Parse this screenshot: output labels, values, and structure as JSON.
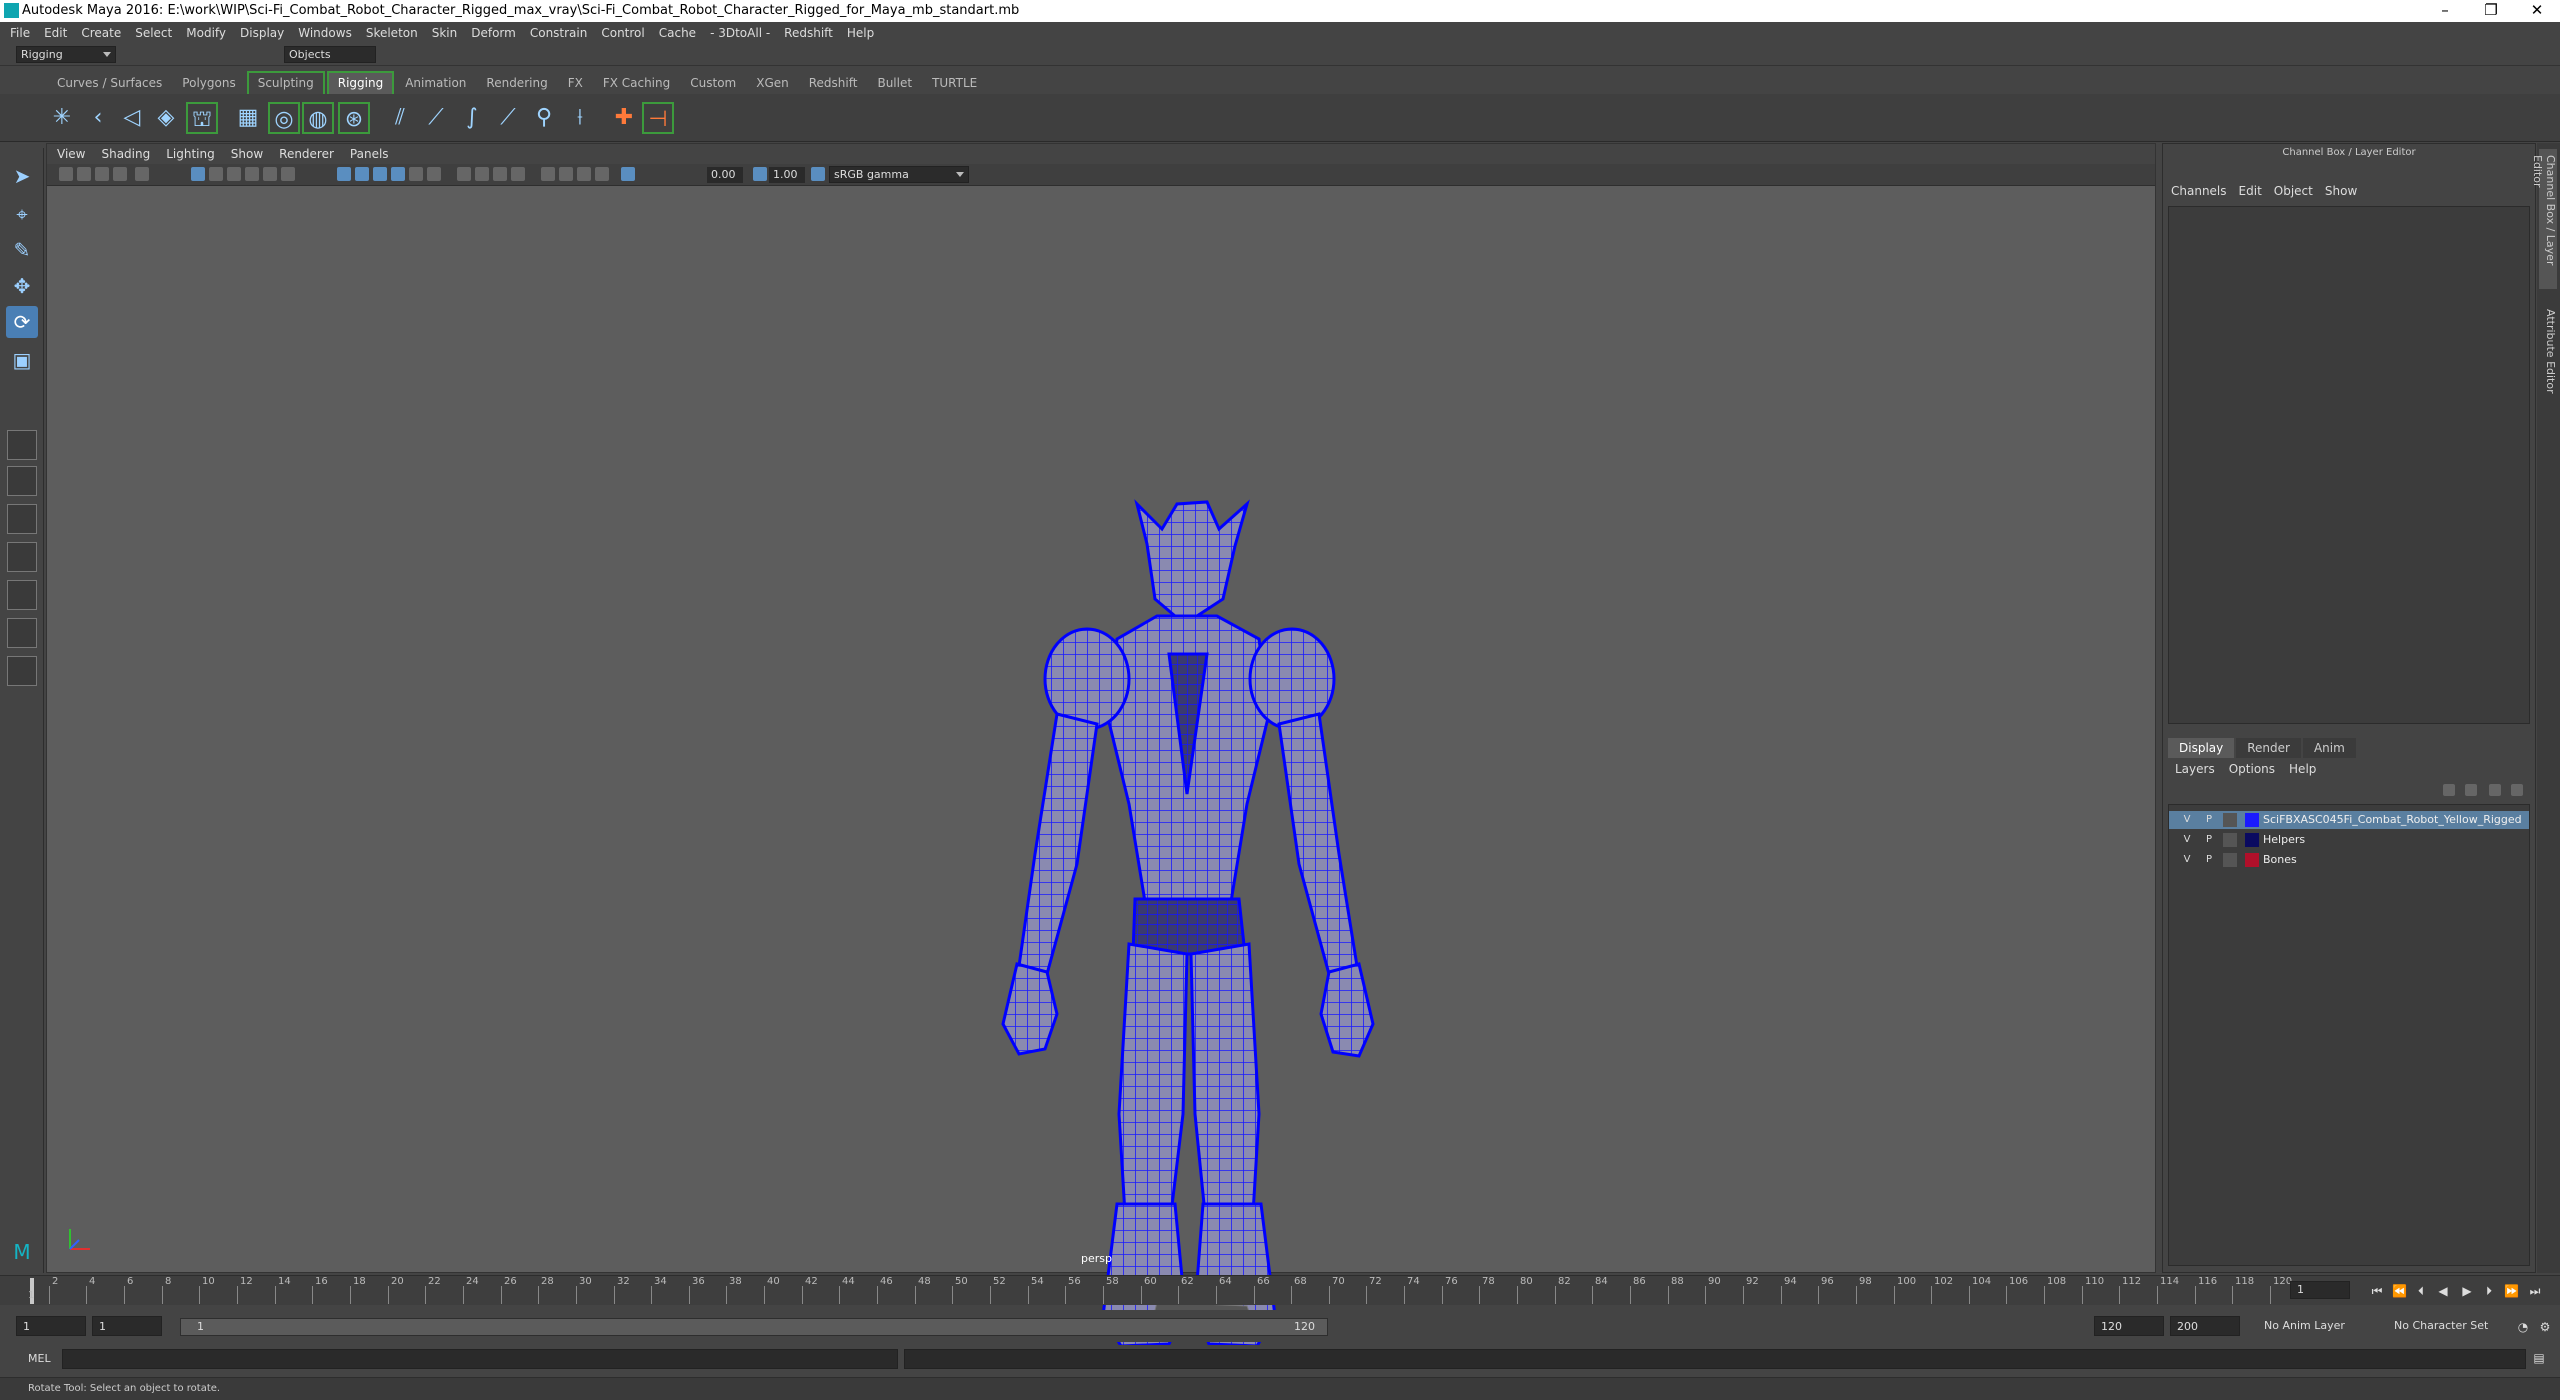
{
  "titlebar": {
    "title": "Autodesk Maya 2016: E:\\work\\WIP\\Sci-Fi_Combat_Robot_Character_Rigged_max_vray\\Sci-Fi_Combat_Robot_Character_Rigged_for_Maya_mb_standart.mb",
    "minimize": "–",
    "restore": "❐",
    "close": "✕"
  },
  "menubar": [
    "File",
    "Edit",
    "Create",
    "Select",
    "Modify",
    "Display",
    "Windows",
    "Skeleton",
    "Skin",
    "Deform",
    "Constrain",
    "Control",
    "Cache",
    "- 3DtoAll -",
    "Redshift",
    "Help"
  ],
  "statusline": {
    "menuset": "Rigging",
    "selmode": "Objects"
  },
  "shelf": {
    "tabs": [
      "Curves / Surfaces",
      "Polygons",
      "Sculpting",
      "Rigging",
      "Animation",
      "Rendering",
      "FX",
      "FX Caching",
      "Custom",
      "XGen",
      "Redshift",
      "Bullet",
      "TURTLE"
    ],
    "active_tab": "Rigging",
    "icons": [
      "joint-icon",
      "ik-handle-icon",
      "ik-spline-icon",
      "insert-joint-icon",
      "skeleton-icon",
      "bind-skin-icon",
      "smooth-bind-icon",
      "paint-weights-icon",
      "lattice-icon",
      "cluster-icon",
      "bend-icon",
      "twist-icon",
      "wave-icon",
      "wire-icon",
      "sculpt-icon",
      "locator-icon",
      "aim-constraint-icon"
    ]
  },
  "viewport": {
    "menu": [
      "View",
      "Shading",
      "Lighting",
      "Show",
      "Renderer",
      "Panels"
    ],
    "exposure": "0.00",
    "gamma": "1.00",
    "colorspace": "sRGB gamma",
    "camera_label": "persp"
  },
  "channelbox": {
    "header": "Channel Box / Layer Editor",
    "menu": [
      "Channels",
      "Edit",
      "Object",
      "Show"
    ]
  },
  "layereditor": {
    "tabs": [
      "Display",
      "Render",
      "Anim"
    ],
    "active_tab": "Display",
    "menu": [
      "Layers",
      "Options",
      "Help"
    ],
    "layers": [
      {
        "v": "V",
        "p": "P",
        "name": "SciFBXASC045Fi_Combat_Robot_Yellow_Rigged",
        "color": "#1a1aff",
        "selected": true
      },
      {
        "v": "V",
        "p": "P",
        "name": "Helpers",
        "color": "#0a0a60",
        "selected": false
      },
      {
        "v": "V",
        "p": "P",
        "name": "Bones",
        "color": "#b0102a",
        "selected": false
      }
    ]
  },
  "sidetabs": [
    "Channel Box / Layer Editor",
    "Attribute Editor"
  ],
  "timeline": {
    "ticks": [
      "2",
      "4",
      "6",
      "8",
      "10",
      "12",
      "14",
      "16",
      "18",
      "20",
      "22",
      "24",
      "26",
      "28",
      "30",
      "32",
      "34",
      "36",
      "38",
      "40",
      "42",
      "44",
      "46",
      "48",
      "50",
      "52",
      "54",
      "56",
      "58",
      "60",
      "62",
      "64",
      "66",
      "68",
      "70",
      "72",
      "74",
      "76",
      "78",
      "80",
      "82",
      "84",
      "86",
      "88",
      "90",
      "92",
      "94",
      "96",
      "98",
      "100",
      "102",
      "104",
      "106",
      "108",
      "110",
      "112",
      "114",
      "116",
      "118",
      "120"
    ],
    "first_label": "1",
    "current_frame": "1"
  },
  "range": {
    "start": "1",
    "playback_start": "1",
    "bar_start": "1",
    "bar_end": "120",
    "playback_end": "120",
    "end": "200",
    "anim_layer": "No Anim Layer",
    "char_set": "No Character Set"
  },
  "cmdline": {
    "lang": "MEL"
  },
  "status": {
    "help": "Rotate Tool: Select an object to rotate."
  },
  "colors": {
    "accent": "#4a7fb5",
    "shelf_highlight": "#3c9a3c",
    "wire": "#1a1aff"
  }
}
